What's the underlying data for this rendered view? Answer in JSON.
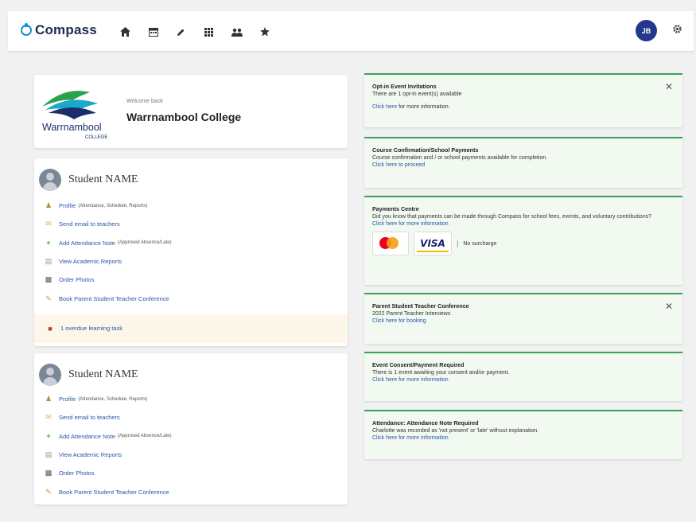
{
  "header": {
    "app_name": "Compass",
    "nav_icons": [
      "home-icon",
      "calendar-icon",
      "pencil-icon",
      "grid-icon",
      "people-icon",
      "star-icon"
    ],
    "avatar_initials": "JB"
  },
  "school": {
    "welcome": "Welcome back",
    "name": "Warrnambool College",
    "logo_text": "Warrnambool",
    "logo_subtext": "COLLEGE"
  },
  "students": [
    {
      "name": "Student NAME",
      "links": [
        {
          "label": "Profile",
          "note": "(Attendance, Schedule, Reports)",
          "icon": "profile-icon"
        },
        {
          "label": "Send email to teachers",
          "note": "",
          "icon": "email-icon"
        },
        {
          "label": "Add Attendance Note",
          "note": "(Approved Absence/Late)",
          "icon": "plus-icon"
        },
        {
          "label": "View Academic Reports",
          "note": "",
          "icon": "reports-icon"
        },
        {
          "label": "Order Photos",
          "note": "",
          "icon": "photo-icon"
        },
        {
          "label": "Book Parent Student Teacher Conference",
          "note": "",
          "icon": "conference-icon"
        }
      ],
      "overdue": "1 overdue learning task"
    },
    {
      "name": "Student NAME",
      "links": [
        {
          "label": "Profile",
          "note": "(Attendance, Schedule, Reports)",
          "icon": "profile-icon"
        },
        {
          "label": "Send email to teachers",
          "note": "",
          "icon": "email-icon"
        },
        {
          "label": "Add Attendance Note",
          "note": "(Approved Absence/Late)",
          "icon": "plus-icon"
        },
        {
          "label": "View Academic Reports",
          "note": "",
          "icon": "reports-icon"
        },
        {
          "label": "Order Photos",
          "note": "",
          "icon": "photo-icon"
        },
        {
          "label": "Book Parent Student Teacher Conference",
          "note": "",
          "icon": "conference-icon"
        }
      ]
    }
  ],
  "notices": [
    {
      "title": "Opt-in Event Invitations",
      "body": "There are 1 opt-in event(s) available",
      "link": "Click here",
      "link_rest": " for more information.",
      "closable": true
    },
    {
      "title": "Course Confirmation/School Payments",
      "body": "Course confirmation and / or school payments available for completion.",
      "link": "Click here to proceed",
      "link_rest": "",
      "closable": false
    },
    {
      "title": "Payments Centre",
      "body": "Did you know that payments can be made through Compass for school fees, events, and voluntary contributions?",
      "link": "Click here for more information",
      "link_rest": "",
      "closable": false,
      "payment": {
        "visa": "VISA",
        "surcharge": "No surcharge"
      }
    },
    {
      "title": "Parent Student Teacher Conference",
      "body": "2022 Parent Teacher Interviews",
      "link": "Click here for booking",
      "link_rest": "",
      "closable": true
    },
    {
      "title": "Event Consent/Payment Required",
      "body": "There is 1 event awaiting your consent and/or payment.",
      "link": "Click here for more information",
      "link_rest": "",
      "closable": false
    },
    {
      "title": "Attendance: Attendance Note Required",
      "body": "Charlotte was recorded as 'not present' or 'late' without explanation.",
      "link": "Click here for more information",
      "link_rest": "",
      "closable": false
    }
  ],
  "colors": {
    "accent": "#3aa35a",
    "link": "#2a55a8",
    "brand": "#1d2c4e",
    "avatar": "#233a8c"
  }
}
